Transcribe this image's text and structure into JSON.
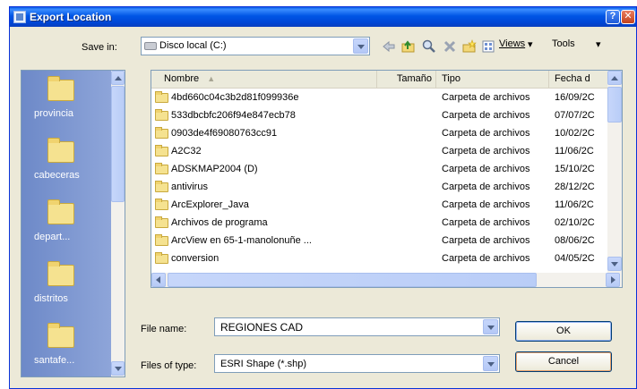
{
  "window": {
    "title": "Export Location"
  },
  "save_in": {
    "label": "Save in:",
    "value": "Disco local (C:)"
  },
  "toolbar": {
    "views_label": "Views",
    "tools_label": "Tools"
  },
  "places": [
    {
      "label": "provincia"
    },
    {
      "label": "cabeceras"
    },
    {
      "label": "depart..."
    },
    {
      "label": "distritos"
    },
    {
      "label": "santafe..."
    }
  ],
  "columns": {
    "name": "Nombre",
    "size": "Tamaño",
    "type": "Tipo",
    "date": "Fecha d"
  },
  "files": [
    {
      "name": "4bd660c04c3b2d81f099936e",
      "type": "Carpeta de archivos",
      "date": "16/09/2C"
    },
    {
      "name": "533dbcbfc206f94e847ecb78",
      "type": "Carpeta de archivos",
      "date": "07/07/2C"
    },
    {
      "name": "0903de4f69080763cc91",
      "type": "Carpeta de archivos",
      "date": "10/02/2C"
    },
    {
      "name": "A2C32",
      "type": "Carpeta de archivos",
      "date": "11/06/2C"
    },
    {
      "name": "ADSKMAP2004 (D)",
      "type": "Carpeta de archivos",
      "date": "15/10/2C"
    },
    {
      "name": "antivirus",
      "type": "Carpeta de archivos",
      "date": "28/12/2C"
    },
    {
      "name": "ArcExplorer_Java",
      "type": "Carpeta de archivos",
      "date": "11/06/2C"
    },
    {
      "name": "Archivos de programa",
      "type": "Carpeta de archivos",
      "date": "02/10/2C"
    },
    {
      "name": "ArcView en 65-1-manolonuñe ...",
      "type": "Carpeta de archivos",
      "date": "08/06/2C"
    },
    {
      "name": "conversion",
      "type": "Carpeta de archivos",
      "date": "04/05/2C"
    }
  ],
  "file_name": {
    "label": "File name:",
    "value": "REGIONES CAD"
  },
  "file_type": {
    "label": "Files of type:",
    "value": "ESRI Shape (*.shp)"
  },
  "buttons": {
    "ok": "OK",
    "cancel": "Cancel"
  },
  "colors": {
    "titlebar": "#0055e5",
    "places_bar": "#7d96c9",
    "dialog_bg": "#ece9d8",
    "folder": "#f5e290"
  }
}
